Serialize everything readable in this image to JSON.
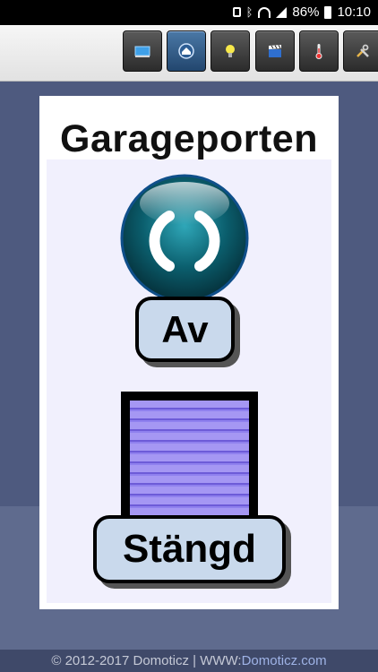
{
  "status_bar": {
    "battery": "86%",
    "time": "10:10",
    "icons": [
      "lock-icon",
      "bluetooth-icon",
      "wifi-icon",
      "signal-icon",
      "battery-icon"
    ]
  },
  "toolbar": {
    "buttons": [
      {
        "name": "dashboard",
        "icon": "monitor-icon",
        "active": false
      },
      {
        "name": "floorplans",
        "icon": "house-icon",
        "active": true
      },
      {
        "name": "switches",
        "icon": "lightbulb-icon",
        "active": false
      },
      {
        "name": "scenes",
        "icon": "clapperboard-icon",
        "active": false
      },
      {
        "name": "temperature",
        "icon": "thermometer-icon",
        "active": false
      },
      {
        "name": "setup",
        "icon": "tools-icon",
        "active": false
      }
    ]
  },
  "card": {
    "title": "Garageporten",
    "toggle_state": "Av",
    "door_state": "Stängd"
  },
  "footer": {
    "copyright": "© 2012-2017 Domoticz | WWW: ",
    "link": "Domoticz.com"
  },
  "colors": {
    "background": "#4e5a7f",
    "card_inner": "#f1f0fd",
    "label_fill": "#c9d9ec",
    "door_slats": "#a597f3",
    "active_button": "#3a6a9a"
  }
}
